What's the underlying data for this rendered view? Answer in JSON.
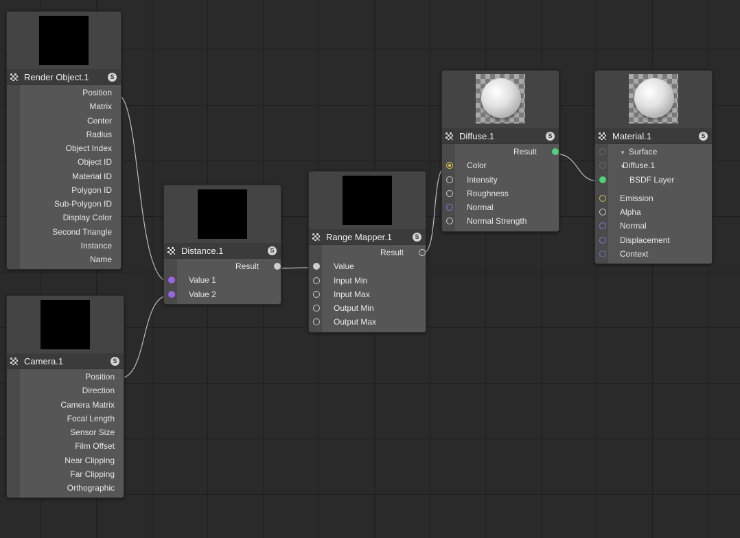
{
  "nodes": {
    "render_object": {
      "title": "Render Object.1",
      "ports": [
        "Position",
        "Matrix",
        "Center",
        "Radius",
        "Object Index",
        "Object ID",
        "Material ID",
        "Polygon ID",
        "Sub-Polygon ID",
        "Display Color",
        "Second Triangle",
        "Instance",
        "Name"
      ]
    },
    "camera": {
      "title": "Camera.1",
      "ports": [
        "Position",
        "Direction",
        "Camera Matrix",
        "Focal Length",
        "Sensor Size",
        "Film Offset",
        "Near Clipping",
        "Far Clipping",
        "Orthographic"
      ]
    },
    "distance": {
      "title": "Distance.1",
      "output": "Result",
      "inputs": [
        "Value 1",
        "Value 2"
      ]
    },
    "range_mapper": {
      "title": "Range Mapper.1",
      "output": "Result",
      "inputs": [
        "Value",
        "Input Min",
        "Input Max",
        "Output Min",
        "Output Max"
      ]
    },
    "diffuse": {
      "title": "Diffuse.1",
      "output": "Result",
      "inputs": [
        "Color",
        "Intensity",
        "Roughness",
        "Normal",
        "Normal Strength"
      ]
    },
    "material": {
      "title": "Material.1",
      "inputs": [
        "Surface",
        "Diffuse.1",
        "BSDF Layer",
        "Emission",
        "Alpha",
        "Normal",
        "Displacement",
        "Context"
      ]
    }
  },
  "solo_label": "S",
  "colors": {
    "canvas": "#2a2a2a",
    "vector_port": "#9a6be0",
    "matrix_port": "#6576c8",
    "color_port": "#d8c04a",
    "float_port": "#cfcfcf",
    "shader_port": "#4fd17a",
    "wire": "#bdbdbd"
  }
}
